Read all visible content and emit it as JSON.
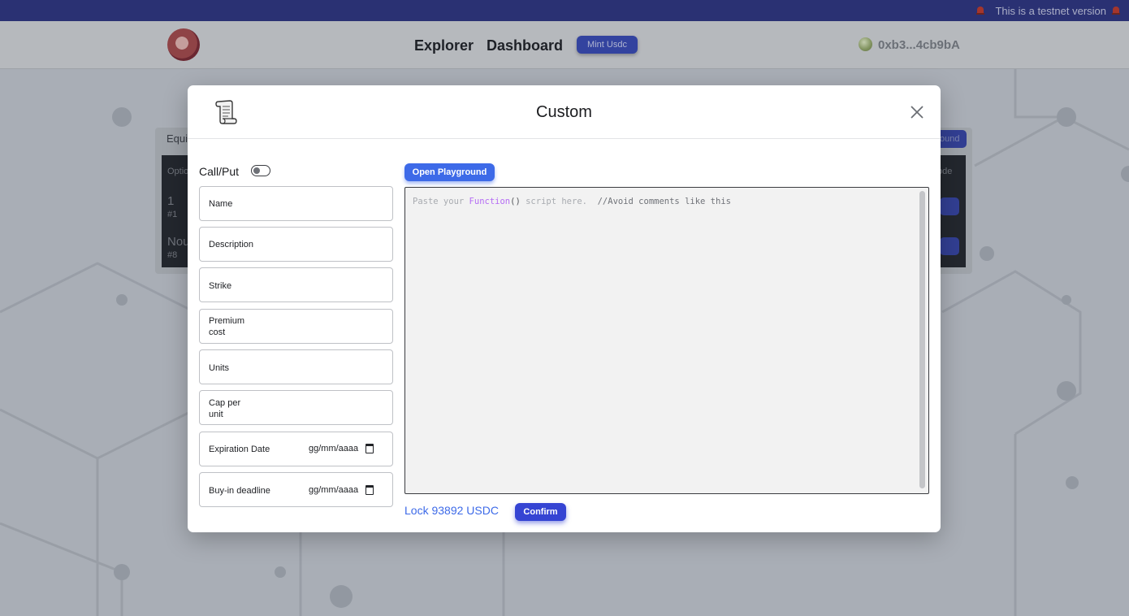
{
  "banner": {
    "text": "This is a testnet version"
  },
  "navbar": {
    "links": [
      "Explorer",
      "Dashboard"
    ],
    "mint_label": "Mint Usdc",
    "wallet_address": "0xb3...4cb9bA"
  },
  "background": {
    "tab_label": "Equi",
    "header_left": "Optio",
    "header_right": "ode",
    "right_button": "ound",
    "rows": [
      {
        "name": "1",
        "id": "#1"
      },
      {
        "name": "Nou",
        "id": "#8"
      }
    ]
  },
  "modal": {
    "title": "Custom",
    "toggle_label": "Call/Put",
    "fields": {
      "name": "Name",
      "description": "Description",
      "strike": "Strike",
      "premium_line1": "Premium",
      "premium_line2": "cost",
      "units": "Units",
      "cap_line1": "Cap per",
      "cap_line2": "unit",
      "expiration": "Expiration Date",
      "expiration_date": "gg/mm/aaaa",
      "buyin": "Buy-in deadline",
      "buyin_date": "gg/mm/aaaa"
    },
    "playground_button": "Open Playground",
    "editor_placeholder": {
      "part1": "Paste your ",
      "keyword": "Function",
      "paren": "()",
      "part2": " script here.",
      "comment": "  //Avoid comments like this"
    },
    "lock_text": "Lock 93892 USDC",
    "confirm_button": "Confirm"
  },
  "colors": {
    "banner_bg": "#2b3381",
    "accent_blue": "#3d6ae8",
    "confirm_blue": "#3544d3",
    "mint_blue": "#3648b6"
  }
}
